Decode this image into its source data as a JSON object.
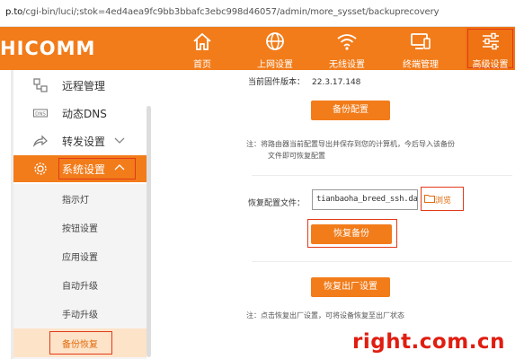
{
  "browser": {
    "url_host": "p.to",
    "url_path": "/cgi-bin/luci/;stok=4ed4aea9fc9bb3bbafc3ebc998d46057/admin/more_sysset/backuprecovery"
  },
  "header": {
    "logo": "HICOMM",
    "nav": [
      {
        "label": "首页",
        "icon": "home-icon"
      },
      {
        "label": "上网设置",
        "icon": "globe-icon"
      },
      {
        "label": "无线设置",
        "icon": "wifi-icon"
      },
      {
        "label": "终端管理",
        "icon": "devices-icon"
      },
      {
        "label": "高级设置",
        "icon": "sliders-icon",
        "active": true
      }
    ]
  },
  "sidebar": {
    "items": [
      {
        "label": "远程管理",
        "icon": "remote-icon"
      },
      {
        "label": "动态DNS",
        "icon": "dns-icon"
      },
      {
        "label": "转发设置",
        "icon": "share-icon"
      },
      {
        "label": "系统设置",
        "icon": "gear-icon",
        "active": true
      }
    ],
    "sub_items": [
      "指示灯",
      "按钮设置",
      "应用设置",
      "自动升级",
      "手动升级",
      "备份恢复"
    ],
    "current_sub": "备份恢复"
  },
  "content": {
    "firmware_label": "当前固件版本：",
    "firmware_version": "22.3.17.148",
    "backup_button": "备份配置",
    "backup_note_1": "注：将路由器当前配置导出并保存到您的计算机，今后导入该备份",
    "backup_note_2": "文件即可恢复配置",
    "restore_label": "恢复配置文件：",
    "restore_file": "tianbaoha_breed_ssh.dat",
    "browse_label": "浏览",
    "restore_button": "恢复备份",
    "factory_button": "恢复出厂设置",
    "factory_note": "注：点击恢复出厂设置，可将设备恢复至出厂状态"
  },
  "watermark": "right.com.cn",
  "colors": {
    "accent": "#f27c1a",
    "highlight_box": "#e23a1a",
    "watermark": "#e01d10"
  }
}
